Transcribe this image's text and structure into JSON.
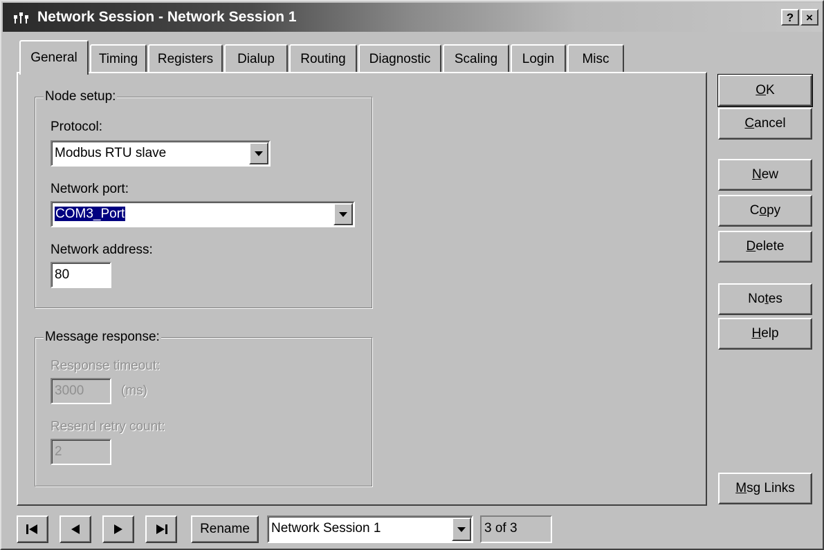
{
  "window": {
    "title": "Network Session - Network Session 1",
    "help_button": "?",
    "close_button": "×"
  },
  "tabs": [
    {
      "label": "General",
      "active": true
    },
    {
      "label": "Timing",
      "active": false
    },
    {
      "label": "Registers",
      "active": false
    },
    {
      "label": "Dialup",
      "active": false
    },
    {
      "label": "Routing",
      "active": false
    },
    {
      "label": "Diagnostic",
      "active": false
    },
    {
      "label": "Scaling",
      "active": false
    },
    {
      "label": "Login",
      "active": false
    },
    {
      "label": "Misc",
      "active": false
    }
  ],
  "node_setup": {
    "group_label": "Node setup:",
    "protocol_label": "Protocol:",
    "protocol_value": "Modbus RTU slave",
    "network_port_label": "Network port:",
    "network_port_value": "COM3_Port",
    "network_address_label": "Network address:",
    "network_address_value": "80"
  },
  "message_response": {
    "group_label": "Message response:",
    "response_timeout_label": "Response timeout:",
    "response_timeout_value": "3000",
    "response_timeout_unit": "(ms)",
    "resend_retry_label": "Resend retry count:",
    "resend_retry_value": "2",
    "disabled": true
  },
  "side_buttons": {
    "ok": {
      "pre": "",
      "ul": "O",
      "post": "K"
    },
    "cancel": {
      "pre": "",
      "ul": "C",
      "post": "ancel"
    },
    "new": {
      "pre": "",
      "ul": "N",
      "post": "ew"
    },
    "copy": {
      "pre": "C",
      "ul": "o",
      "post": "py"
    },
    "delete": {
      "pre": "",
      "ul": "D",
      "post": "elete"
    },
    "notes": {
      "pre": "No",
      "ul": "t",
      "post": "es"
    },
    "help": {
      "pre": "",
      "ul": "H",
      "post": "elp"
    },
    "msg_links": {
      "pre": "",
      "ul": "M",
      "post": "sg Links"
    }
  },
  "navigator": {
    "rename_label": "Rename",
    "session_value": "Network Session 1",
    "counter": "3 of 3"
  },
  "icons": {
    "first": "first-record-icon",
    "prev": "previous-record-icon",
    "next": "next-record-icon",
    "last": "last-record-icon",
    "app": "network-session-icon"
  }
}
